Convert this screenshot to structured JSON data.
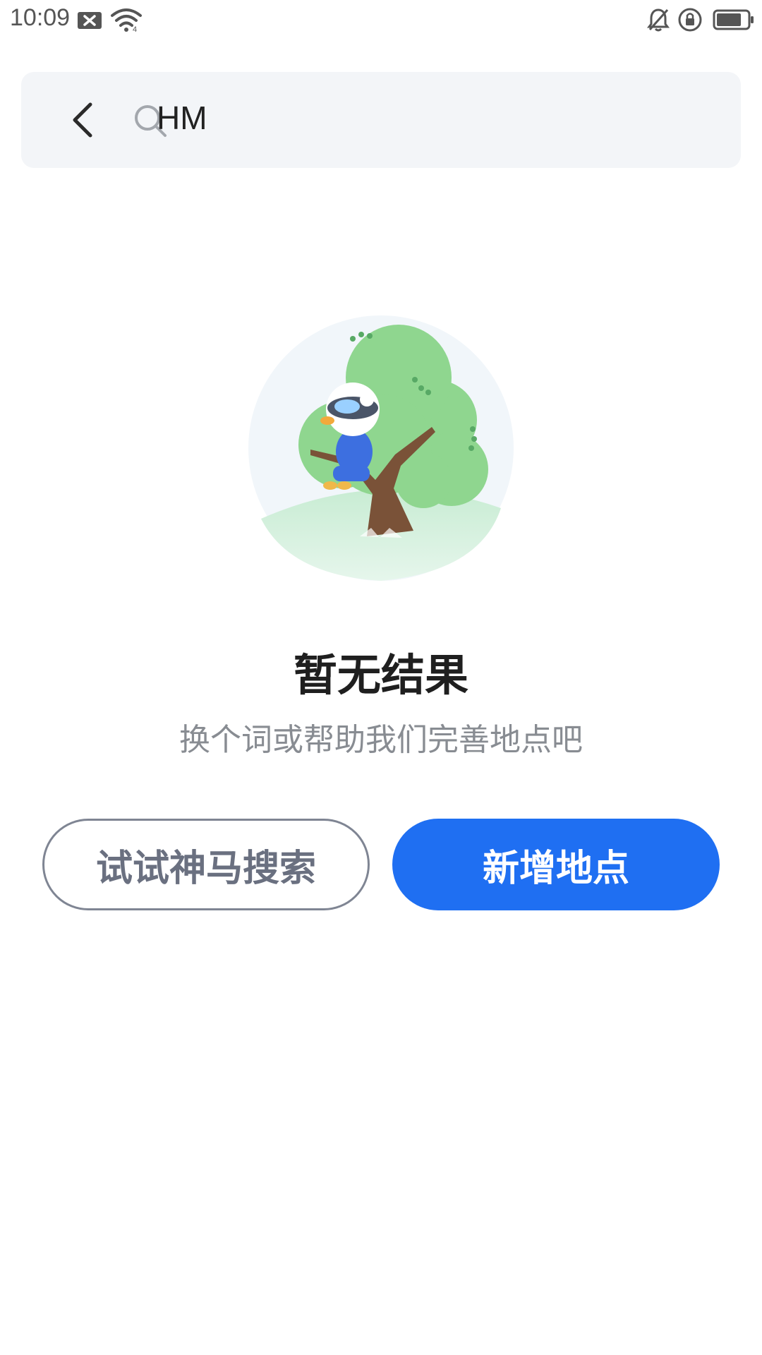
{
  "status_bar": {
    "time": "10:09"
  },
  "search": {
    "query": "HM"
  },
  "empty_state": {
    "title": "暂无结果",
    "subtitle": "换个词或帮助我们完善地点吧"
  },
  "actions": {
    "secondary_label": "试试神马搜索",
    "primary_label": "新增地点"
  },
  "colors": {
    "primary": "#1f6ff2",
    "outline": "#7f8593",
    "search_bg": "#f3f5f8",
    "illustration_green": "#8fd68f"
  }
}
